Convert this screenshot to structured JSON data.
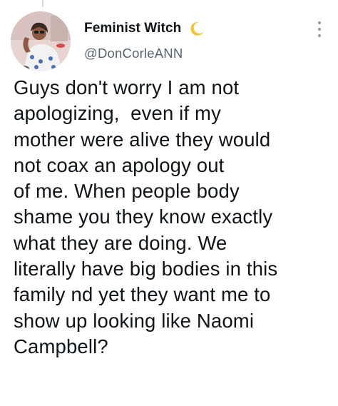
{
  "author": {
    "display_name": "Feminist Witch",
    "handle": "@DonCorleANN",
    "name_emoji": "crescent-moon-icon"
  },
  "menu": {
    "icon": "more-vertical-icon"
  },
  "tweet": {
    "text": "Guys don't worry I am not\napologizing,  even if my\nmother were alive they would\nnot coax an apology out\nof me. When people body\nshame you they know exactly\nwhat they are doing. We\nliterally have big bodies in this\nfamily nd yet they want me to\nshow up looking like Naomi\nCampbell?"
  },
  "colors": {
    "text": "#0f1419",
    "secondary": "#536471",
    "moon": "#f4c430",
    "thread_line": "#cfd9de"
  }
}
